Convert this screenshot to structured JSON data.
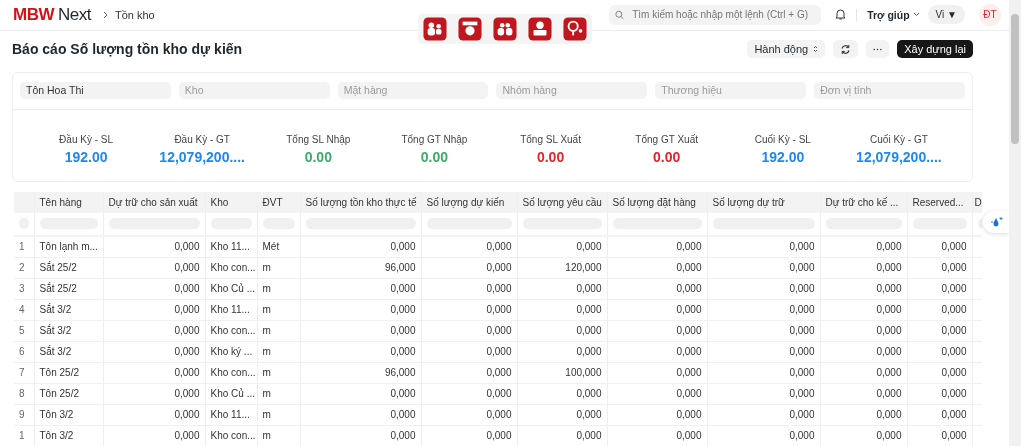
{
  "header": {
    "logo_brand": "MBW",
    "logo_product": "Next",
    "breadcrumb": "Tồn kho",
    "search": {
      "placeholder": "Tìm kiếm hoặc nhập một lệnh (Ctrl + G)"
    },
    "help": "Trợ giúp",
    "language": "Vi ▼",
    "avatar": "ĐT"
  },
  "app_shortcuts": [
    {
      "kind": "people"
    },
    {
      "kind": "register"
    },
    {
      "kind": "group"
    },
    {
      "kind": "user"
    },
    {
      "kind": "location"
    }
  ],
  "page": {
    "title": "Báo cáo Số lượng tồn kho dự kiến",
    "actions_menu": "Hành động",
    "primary_button": "Xây dựng lại"
  },
  "filters": [
    {
      "value": "Tôn Hoa Thi"
    },
    {
      "placeholder": "Kho"
    },
    {
      "placeholder": "Mặt hàng"
    },
    {
      "placeholder": "Nhóm hàng"
    },
    {
      "placeholder": "Thương hiệu"
    },
    {
      "placeholder": "Đơn vị tính"
    }
  ],
  "summary": [
    {
      "label": "Đầu Kỳ - SL",
      "value": "192.00",
      "color": "#1e88f0"
    },
    {
      "label": "Đầu Kỳ - GT",
      "value": "12,079,200....",
      "color": "#1e88f0"
    },
    {
      "label": "Tổng SL Nhập",
      "value": "0.00",
      "color": "#3daa6a"
    },
    {
      "label": "Tổng GT Nhập",
      "value": "0.00",
      "color": "#3daa6a"
    },
    {
      "label": "Tổng SL Xuất",
      "value": "0.00",
      "color": "#e0242c"
    },
    {
      "label": "Tổng GT Xuất",
      "value": "0.00",
      "color": "#e0242c"
    },
    {
      "label": "Cuối Kỳ - SL",
      "value": "192.00",
      "color": "#1e88f0"
    },
    {
      "label": "Cuối Kỳ - GT",
      "value": "12,079,200....",
      "color": "#1e88f0"
    }
  ],
  "table": {
    "columns": [
      {
        "label": "Tên hàng",
        "kind": "text"
      },
      {
        "label": "Dự trữ cho sản xuất",
        "kind": "number"
      },
      {
        "label": "Kho",
        "kind": "text"
      },
      {
        "label": "ĐVT",
        "kind": "text"
      },
      {
        "label": "Số lượng tồn kho thực tế",
        "kind": "number"
      },
      {
        "label": "Số lượng dự kiến",
        "kind": "number"
      },
      {
        "label": "Số lượng yêu cầu",
        "kind": "number"
      },
      {
        "label": "Số lượng đặt hàng",
        "kind": "number"
      },
      {
        "label": "Số lượng dự trữ",
        "kind": "number"
      },
      {
        "label": "Dự trữ cho kế ...",
        "kind": "number"
      },
      {
        "label": "Reserved...",
        "kind": "number"
      },
      {
        "label": "D",
        "kind": "text"
      }
    ],
    "rows": [
      {
        "index": "1",
        "cells": [
          "Tôn lạnh m...",
          "0,000",
          "Kho 11...",
          "Mét",
          "0,000",
          "0,000",
          "0,000",
          "0,000",
          "0,000",
          "0,000",
          "0,000"
        ]
      },
      {
        "index": "2",
        "cells": [
          "Sắt 25/2",
          "0,000",
          "Kho con...",
          "m",
          "96,000",
          "0,000",
          "120,000",
          "0,000",
          "0,000",
          "0,000",
          "0,000"
        ]
      },
      {
        "index": "3",
        "cells": [
          "Sắt 25/2",
          "0,000",
          "Kho Củ ...",
          "m",
          "0,000",
          "0,000",
          "0,000",
          "0,000",
          "0,000",
          "0,000",
          "0,000"
        ]
      },
      {
        "index": "4",
        "cells": [
          "Sắt 3/2",
          "0,000",
          "Kho 11...",
          "m",
          "0,000",
          "0,000",
          "0,000",
          "0,000",
          "0,000",
          "0,000",
          "0,000"
        ]
      },
      {
        "index": "5",
        "cells": [
          "Sắt 3/2",
          "0,000",
          "Kho con...",
          "m",
          "0,000",
          "0,000",
          "0,000",
          "0,000",
          "0,000",
          "0,000",
          "0,000"
        ]
      },
      {
        "index": "6",
        "cells": [
          "Sắt 3/2",
          "0,000",
          "Kho ký ...",
          "m",
          "0,000",
          "0,000",
          "0,000",
          "0,000",
          "0,000",
          "0,000",
          "0,000"
        ]
      },
      {
        "index": "7",
        "cells": [
          "Tôn 25/2",
          "0,000",
          "Kho con...",
          "m",
          "96,000",
          "0,000",
          "100,000",
          "0,000",
          "0,000",
          "0,000",
          "0,000"
        ]
      },
      {
        "index": "8",
        "cells": [
          "Tôn 25/2",
          "0,000",
          "Kho Củ ...",
          "m",
          "0,000",
          "0,000",
          "0,000",
          "0,000",
          "0,000",
          "0,000",
          "0,000"
        ]
      },
      {
        "index": "9",
        "cells": [
          "Tôn 3/2",
          "0,000",
          "Kho 11...",
          "m",
          "0,000",
          "0,000",
          "0,000",
          "0,000",
          "0,000",
          "0,000",
          "0,000"
        ]
      },
      {
        "index": "1",
        "cells": [
          "Tôn 3/2",
          "0,000",
          "Kho con...",
          "m",
          "0,000",
          "0,000",
          "0,000",
          "0,000",
          "0,000",
          "0,000",
          "0,000"
        ]
      }
    ]
  }
}
